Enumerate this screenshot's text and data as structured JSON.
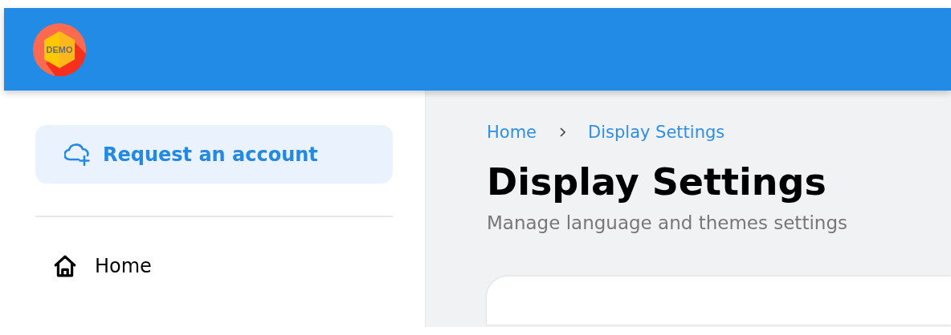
{
  "header": {
    "logo_text": "DEMO"
  },
  "sidebar": {
    "action": {
      "label": "Request an account"
    },
    "items": [
      {
        "label": "Home",
        "selected": false
      }
    ]
  },
  "breadcrumb": [
    {
      "label": "Home"
    },
    {
      "label": "Display Settings"
    }
  ],
  "page": {
    "title": "Display Settings",
    "subtitle": "Manage language and themes settings"
  }
}
